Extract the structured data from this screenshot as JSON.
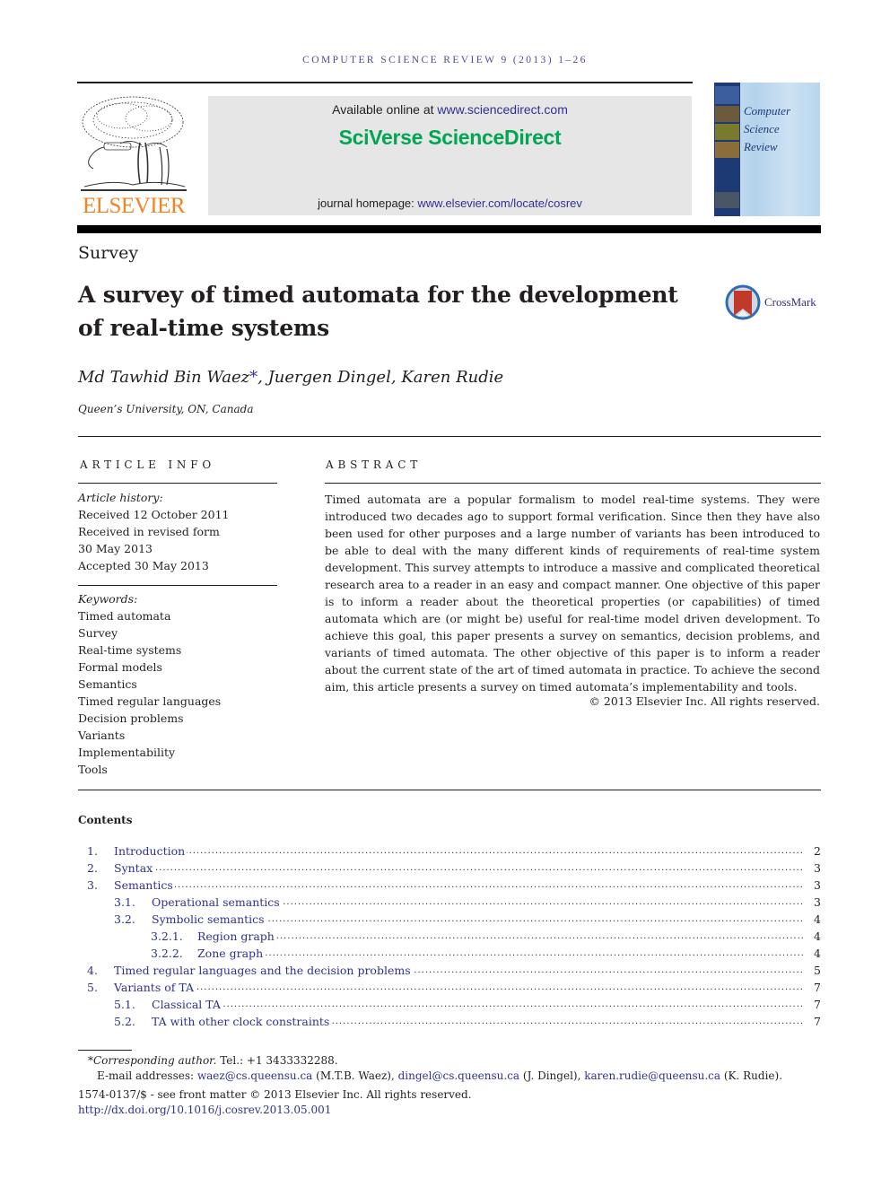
{
  "header": {
    "running_head": "COMPUTER SCIENCE REVIEW 9 (2013) 1–26",
    "publisher_logo_text": "ELSEVIER",
    "available_online_prefix": "Available online at ",
    "available_online_link": "www.sciencedirect.com",
    "platform_brand": "SciVerse ScienceDirect",
    "homepage_prefix": "journal homepage: ",
    "homepage_link": "www.elsevier.com/locate/cosrev",
    "cover_title_lines": [
      "Computer",
      "Science",
      "Review"
    ]
  },
  "article": {
    "section_type": "Survey",
    "title": "A survey of timed automata for the development of real-time systems",
    "crossmark_label": "CrossMark",
    "authors": [
      {
        "name": "Md Tawhid Bin Waez",
        "mark": "*"
      },
      {
        "name": "Juergen Dingel",
        "mark": ""
      },
      {
        "name": "Karen Rudie",
        "mark": ""
      }
    ],
    "affiliation": "Queen’s University, ON, Canada"
  },
  "article_info": {
    "heading": "ARTICLE INFO",
    "history_label": "Article history:",
    "history": [
      "Received 12 October 2011",
      "Received in revised form",
      "30 May 2013",
      "Accepted 30 May 2013"
    ],
    "keywords_label": "Keywords:",
    "keywords": [
      "Timed automata",
      "Survey",
      "Real-time systems",
      "Formal models",
      "Semantics",
      "Timed regular languages",
      "Decision problems",
      "Variants",
      "Implementability",
      "Tools"
    ]
  },
  "abstract": {
    "heading": "ABSTRACT",
    "text": "Timed automata are a popular formalism to model real-time systems. They were introduced two decades ago to support formal verification. Since then they have also been used for other purposes and a large number of variants has been introduced to be able to deal with the many different kinds of requirements of real-time system development. This survey attempts to introduce a massive and complicated theoretical research area to a reader in an easy and compact manner. One objective of this paper is to inform a reader about the theoretical properties (or capabilities) of timed automata which are (or might be) useful for real-time model driven development. To achieve this goal, this paper presents a survey on semantics, decision problems, and variants of timed automata. The other objective of this paper is to inform a reader about the current state of the art of timed automata in practice. To achieve the second aim, this article presents a survey on timed automata’s implementability and tools.",
    "copyright": "© 2013 Elsevier Inc. All rights reserved."
  },
  "contents": {
    "heading": "Contents",
    "entries": [
      {
        "num": "1.",
        "title": "Introduction",
        "page": "2",
        "level": 0
      },
      {
        "num": "2.",
        "title": "Syntax",
        "page": "3",
        "level": 0
      },
      {
        "num": "3.",
        "title": "Semantics",
        "page": "3",
        "level": 0
      },
      {
        "num": "3.1.",
        "title": "Operational semantics",
        "page": "3",
        "level": 1
      },
      {
        "num": "3.2.",
        "title": "Symbolic semantics",
        "page": "4",
        "level": 1
      },
      {
        "num": "3.2.1.",
        "title": "Region graph",
        "page": "4",
        "level": 2
      },
      {
        "num": "3.2.2.",
        "title": "Zone graph",
        "page": "4",
        "level": 2
      },
      {
        "num": "4.",
        "title": "Timed regular languages and the decision problems",
        "page": "5",
        "level": 0
      },
      {
        "num": "5.",
        "title": "Variants of TA",
        "page": "7",
        "level": 0
      },
      {
        "num": "5.1.",
        "title": "Classical TA",
        "page": "7",
        "level": 1
      },
      {
        "num": "5.2.",
        "title": "TA with other clock constraints",
        "page": "7",
        "level": 1
      }
    ]
  },
  "footer": {
    "corresponding_mark": "*",
    "corresponding_label": "Corresponding author.",
    "tel": " Tel.: +1 3433332288.",
    "email_label": "E-mail addresses: ",
    "emails": [
      {
        "address": "waez@cs.queensu.ca",
        "owner": " (M.T.B. Waez), "
      },
      {
        "address": "dingel@cs.queensu.ca",
        "owner": " (J. Dingel), "
      },
      {
        "address": "karen.rudie@queensu.ca",
        "owner": " (K. Rudie)."
      }
    ],
    "front_matter": "1574-0137/$ - see front matter © 2013 Elsevier Inc. All rights reserved.",
    "doi": "http://dx.doi.org/10.1016/j.cosrev.2013.05.001"
  }
}
